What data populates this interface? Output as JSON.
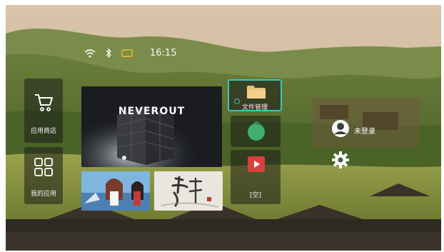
{
  "status_bar": {
    "icons": [
      "wifi-icon",
      "bluetooth-icon",
      "screen-cast-icon"
    ],
    "time": "16:15"
  },
  "left_tiles": [
    {
      "label": "应用商店",
      "icon": "shopping-cart-icon"
    },
    {
      "label": "我的应用",
      "icon": "app-grid-icon"
    }
  ],
  "banner": {
    "title": "NEVEROUT"
  },
  "app_tiles": [
    {
      "label": "文件管理",
      "icon": "folder-icon",
      "focused": true
    },
    {
      "label": "",
      "icon": "green-leaf-app-icon"
    },
    {
      "label": "[空]",
      "icon": "video-player-icon"
    }
  ],
  "side_buttons": {
    "account_label": "未登录",
    "account_icon": "account-icon",
    "settings_icon": "gear-icon"
  },
  "colors": {
    "focus_outline": "#3cc7b6",
    "folder": "#e8c27a",
    "leaf": "#3fae6e",
    "video": "#d94040"
  }
}
